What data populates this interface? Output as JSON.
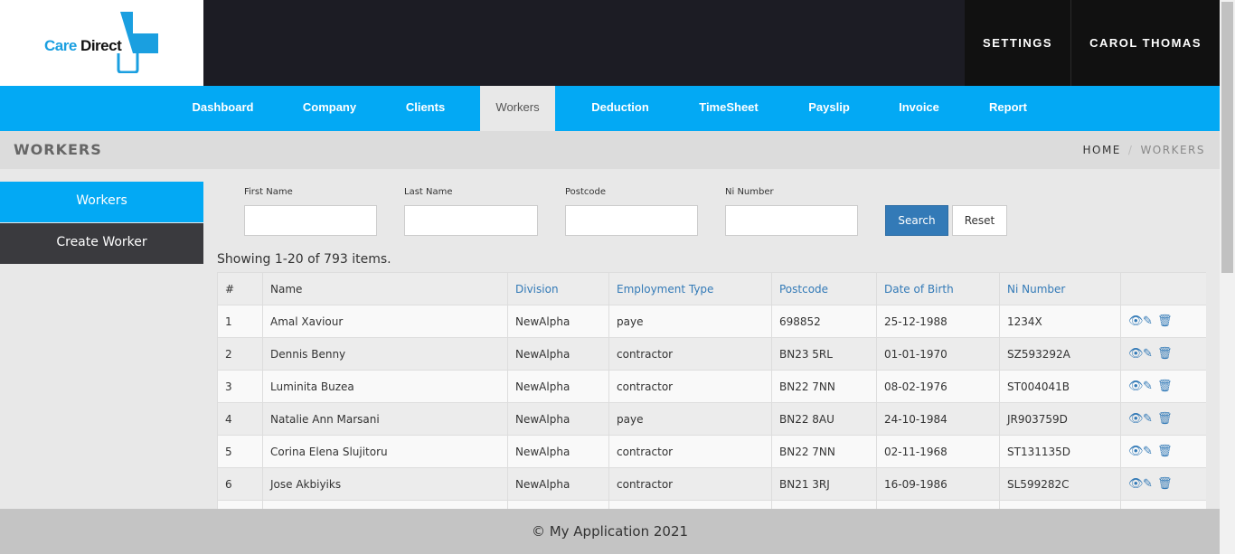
{
  "brand": {
    "care": "Care",
    "direct": "Direct",
    "color_primary": "#03a9f4",
    "color_dark": "#1c1c24"
  },
  "header": {
    "settings": "SETTINGS",
    "user": "CAROL THOMAS"
  },
  "nav": {
    "dashboard": "Dashboard",
    "company": "Company",
    "clients": "Clients",
    "workers": "Workers",
    "deduction": "Deduction",
    "timesheet": "TimeSheet",
    "payslip": "Payslip",
    "invoice": "Invoice",
    "report": "Report"
  },
  "page": {
    "title": "WORKERS",
    "breadcrumb_home": "HOME",
    "breadcrumb_sep": "/",
    "breadcrumb_current": "WORKERS"
  },
  "sidebar": {
    "workers": "Workers",
    "create_worker": "Create Worker"
  },
  "search": {
    "first_name_label": "First Name",
    "last_name_label": "Last Name",
    "postcode_label": "Postcode",
    "ni_label": "Ni Number",
    "first_name_value": "",
    "last_name_value": "",
    "postcode_value": "",
    "ni_value": "",
    "search_button": "Search",
    "reset_button": "Reset"
  },
  "summary": "Showing 1-20 of 793 items.",
  "table": {
    "headers": {
      "num": "#",
      "name": "Name",
      "division": "Division",
      "employment_type": "Employment Type",
      "postcode": "Postcode",
      "dob": "Date of Birth",
      "ni": "Ni Number"
    },
    "rows": [
      {
        "num": "1",
        "name": "Amal Xaviour",
        "division": "NewAlpha",
        "type": "paye",
        "postcode": "698852",
        "dob": "25-12-1988",
        "ni": "1234X"
      },
      {
        "num": "2",
        "name": "Dennis Benny",
        "division": "NewAlpha",
        "type": "contractor",
        "postcode": "BN23 5RL",
        "dob": "01-01-1970",
        "ni": "SZ593292A"
      },
      {
        "num": "3",
        "name": "Luminita Buzea",
        "division": "NewAlpha",
        "type": "contractor",
        "postcode": "BN22 7NN",
        "dob": "08-02-1976",
        "ni": "ST004041B"
      },
      {
        "num": "4",
        "name": "Natalie Ann Marsani",
        "division": "NewAlpha",
        "type": "paye",
        "postcode": "BN22 8AU",
        "dob": "24-10-1984",
        "ni": "JR903759D"
      },
      {
        "num": "5",
        "name": "Corina Elena Slujitoru",
        "division": "NewAlpha",
        "type": "contractor",
        "postcode": "BN22 7NN",
        "dob": "02-11-1968",
        "ni": "ST131135D"
      },
      {
        "num": "6",
        "name": "Jose Akbiyiks",
        "division": "NewAlpha",
        "type": "contractor",
        "postcode": "BN21 3RJ",
        "dob": "16-09-1986",
        "ni": "SL599282C"
      },
      {
        "num": "",
        "name": "",
        "division": "",
        "type": "",
        "postcode": "",
        "dob": "",
        "ni": ""
      }
    ]
  },
  "footer": "© My Application 2021"
}
